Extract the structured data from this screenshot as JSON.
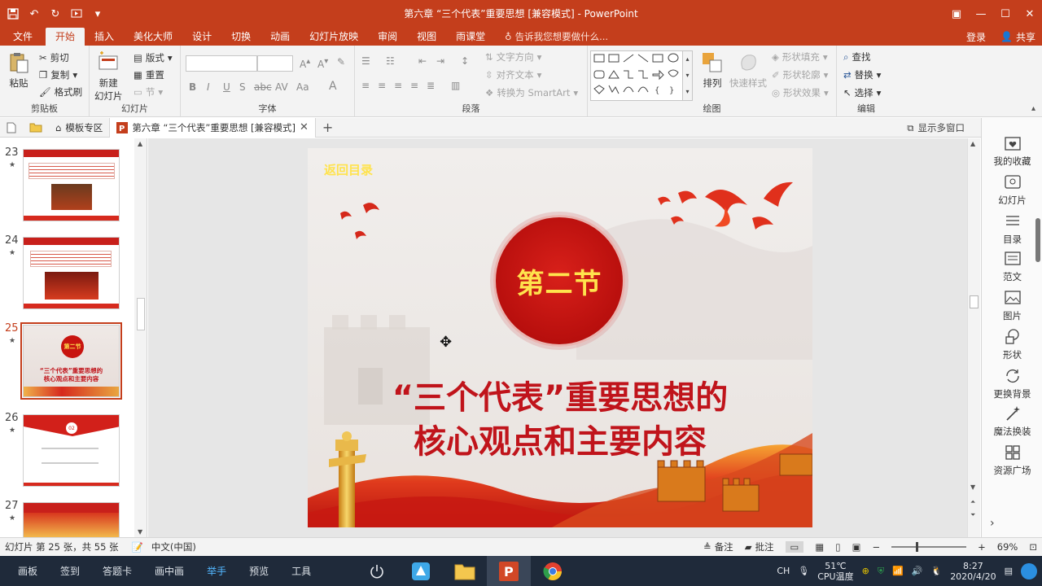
{
  "window": {
    "title": "第六章 “三个代表”重要思想 [兼容模式] - PowerPoint"
  },
  "ribbon_tabs": [
    "文件",
    "开始",
    "插入",
    "美化大师",
    "设计",
    "切换",
    "动画",
    "幻灯片放映",
    "审阅",
    "视图",
    "雨课堂"
  ],
  "active_tab": "开始",
  "tell_me": "告诉我您想要做什么...",
  "account": {
    "login": "登录",
    "share": "共享"
  },
  "clipboard": {
    "paste": "粘贴",
    "cut": "剪切",
    "copy": "复制",
    "format_painter": "格式刷",
    "label": "剪贴板"
  },
  "slides_group": {
    "new_slide_line1": "新建",
    "new_slide_line2": "幻灯片",
    "layout": "版式",
    "reset": "重置",
    "section": "节",
    "label": "幻灯片"
  },
  "font_group": {
    "label": "字体"
  },
  "paragraph_group": {
    "text_direction": "文字方向",
    "align_text": "对齐文本",
    "smartart": "转换为 SmartArt",
    "label": "段落"
  },
  "drawing_group": {
    "arrange": "排列",
    "quick_styles": "快速样式",
    "shape_fill": "形状填充",
    "shape_outline": "形状轮廓",
    "shape_effects": "形状效果",
    "label": "绘图"
  },
  "editing_group": {
    "find": "查找",
    "replace": "替换",
    "select": "选择",
    "label": "编辑"
  },
  "doc_tabs": {
    "template": "模板专区",
    "document": "第六章 “三个代表”重要思想 [兼容模式]",
    "multi_window": "显示多窗口"
  },
  "thumbnails": [
    {
      "num": "23",
      "star": "★"
    },
    {
      "num": "24",
      "star": "★"
    },
    {
      "num": "25",
      "star": "★"
    },
    {
      "num": "26",
      "star": "★"
    },
    {
      "num": "27",
      "star": "★"
    }
  ],
  "thumb_texts": {
    "s25_circle": "第二节",
    "s25_line1": "“三个代表”重要思想的",
    "s25_line2": "核心观点和主要内容",
    "s26_badge": "02"
  },
  "slide": {
    "back_link": "返回目录",
    "section": "第二节",
    "title_line1": "“三个代表”重要思想的",
    "title_line2": "核心观点和主要内容"
  },
  "task_pane": [
    "我的收藏",
    "幻灯片",
    "目录",
    "范文",
    "图片",
    "形状",
    "更换背景",
    "魔法换装",
    "资源广场"
  ],
  "status": {
    "slide_count": "幻灯片 第 25 张，共 55 张",
    "language": "中文(中国)",
    "notes": "备注",
    "comments": "批注",
    "zoom": "69%"
  },
  "taskbar": {
    "items": [
      "画板",
      "签到",
      "答题卡",
      "画中画",
      "举手",
      "预览",
      "工具"
    ],
    "highlight": "举手",
    "ime": "CH",
    "temp": "51℃",
    "cpu_label": "CPU温度",
    "time": "8:27",
    "date": "2020/4/20"
  },
  "colors": {
    "accent": "#c43e1c",
    "slide_red": "#c0141b",
    "slide_yellow": "#ffe34d"
  }
}
